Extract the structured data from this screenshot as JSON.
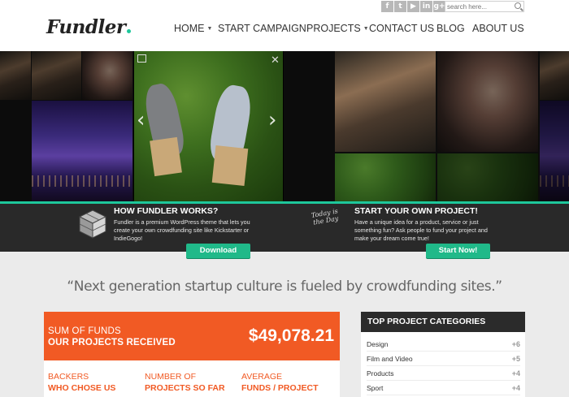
{
  "header": {
    "logo": "Fundler",
    "social": [
      "f",
      "t",
      "▶",
      "in",
      "g+"
    ],
    "social_icons": [
      "facebook-icon",
      "twitter-icon",
      "youtube-icon",
      "linkedin-icon",
      "google-plus-icon"
    ],
    "search_placeholder": "search here...",
    "nav": [
      {
        "label": "HOME",
        "dropdown": true
      },
      {
        "label": "START CAMPAIGN",
        "dropdown": false
      },
      {
        "label": "PROJECTS",
        "dropdown": true
      },
      {
        "label": "CONTACT US",
        "dropdown": false
      },
      {
        "label": "BLOG",
        "dropdown": false
      },
      {
        "label": "ABOUT US",
        "dropdown": false
      }
    ]
  },
  "info": {
    "how": {
      "title": "HOW FUNDLER WORKS?",
      "text": "Fundler is a premium WordPress theme that lets you create your own crowdfunding site like Kickstarter or IndieGogo!",
      "button": "Download"
    },
    "start": {
      "title": "START YOUR OWN PROJECT!",
      "text": "Have a unique idea for a product, service or just something fun? Ask people to fund your project and make your dream come true!",
      "button": "Start Now!",
      "badge": "Today is the Day"
    }
  },
  "quote": "“Next generation startup culture is fueled by crowdfunding sites.”",
  "funds": {
    "label1": "SUM OF FUNDS",
    "label2": "OUR PROJECTS RECEIVED",
    "amount": "$49,078.21",
    "stats": [
      {
        "a": "BACKERS",
        "b": "WHO CHOSE US"
      },
      {
        "a": "NUMBER OF",
        "b": "PROJECTS SO FAR"
      },
      {
        "a": "AVERAGE",
        "b": "FUNDS / PROJECT"
      }
    ]
  },
  "categories": {
    "title": "TOP PROJECT CATEGORIES",
    "items": [
      {
        "name": "Design",
        "count": "+6"
      },
      {
        "name": "Film and Video",
        "count": "+5"
      },
      {
        "name": "Products",
        "count": "+4"
      },
      {
        "name": "Sport",
        "count": "+4"
      }
    ]
  },
  "colors": {
    "accent_green": "#1ec79b",
    "orange": "#f15a24",
    "dark": "#292929"
  }
}
